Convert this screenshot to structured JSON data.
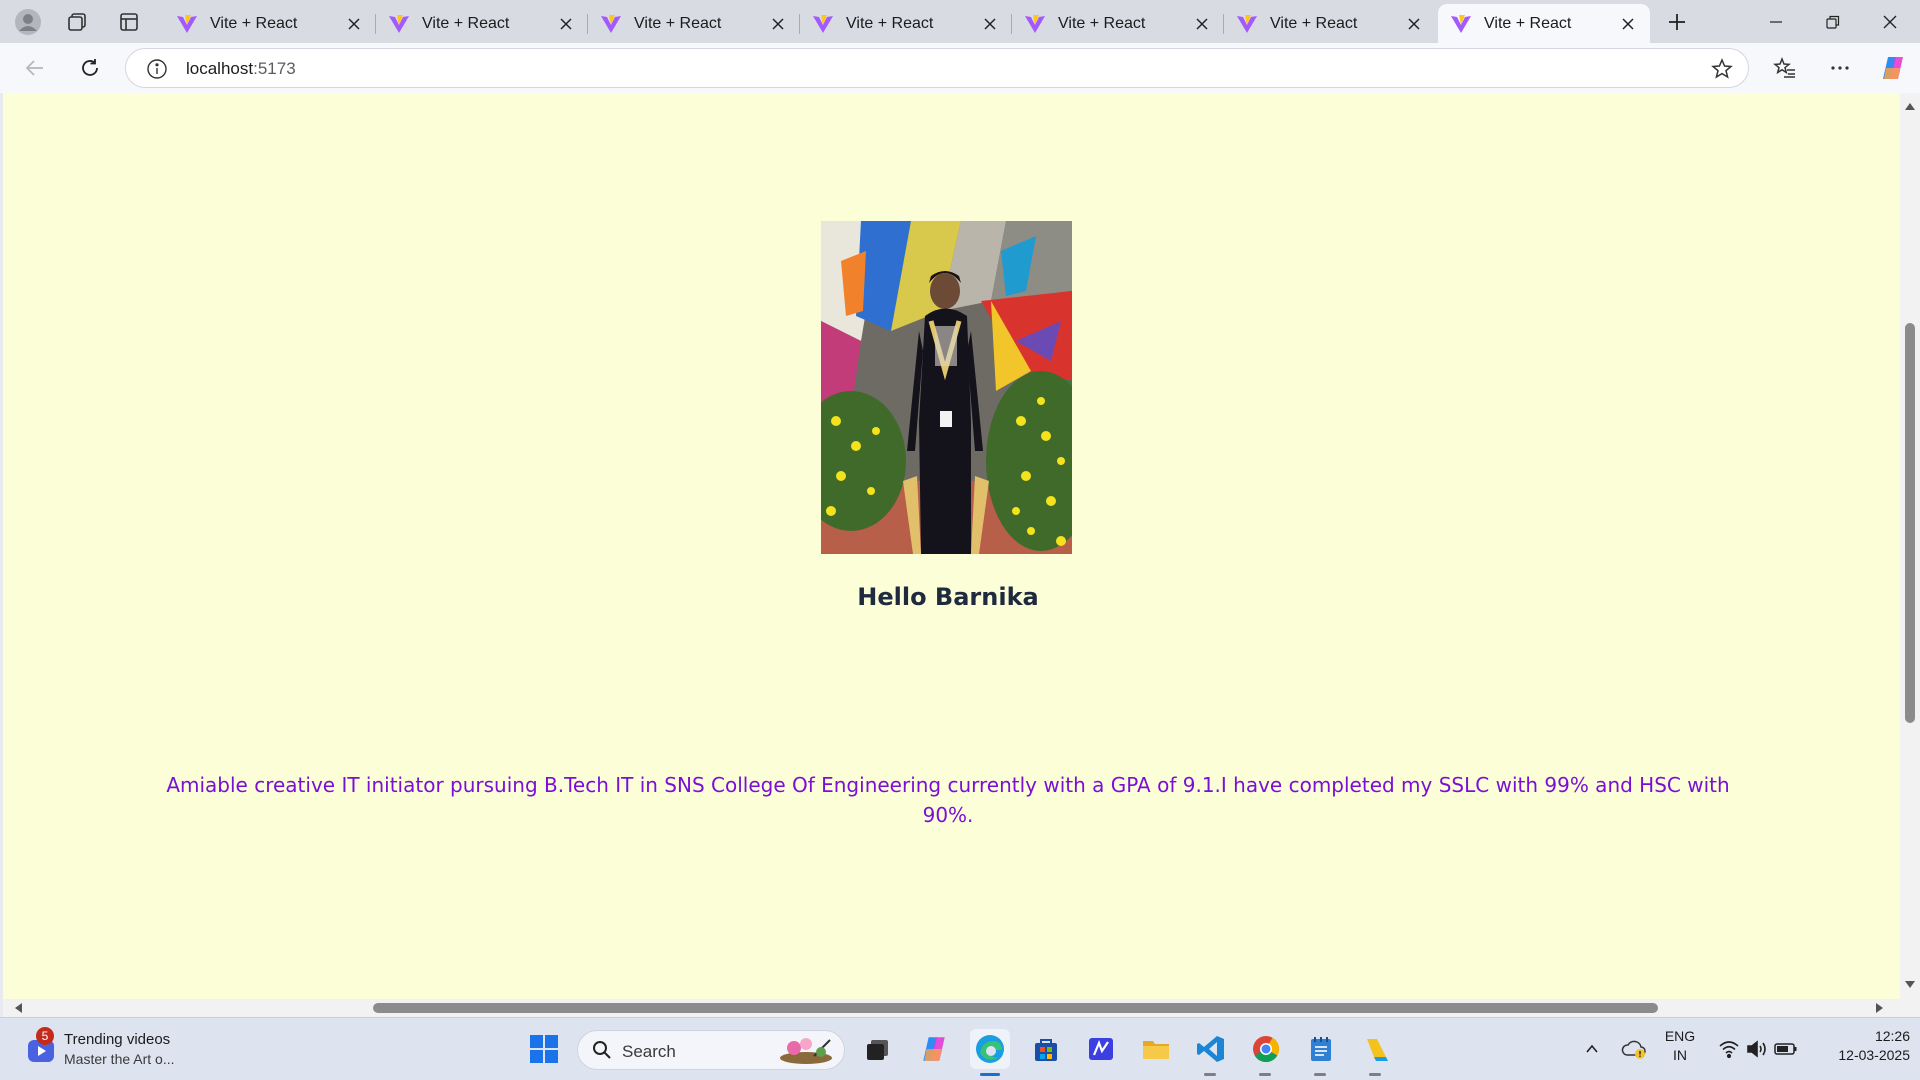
{
  "browser": {
    "tabs": [
      {
        "title": "Vite + React",
        "active": false
      },
      {
        "title": "Vite + React",
        "active": false
      },
      {
        "title": "Vite + React",
        "active": false
      },
      {
        "title": "Vite + React",
        "active": false
      },
      {
        "title": "Vite + React",
        "active": false
      },
      {
        "title": "Vite + React",
        "active": false
      },
      {
        "title": "Vite + React",
        "active": true
      }
    ],
    "address": {
      "host": "localhost",
      "port": ":5173"
    }
  },
  "page": {
    "greeting": "Hello Barnika",
    "bio": "Amiable creative IT initiator pursuing B.Tech IT in SNS College Of Engineering currently with a GPA of 9.1.I have completed my SSLC with 99% and HSC with 90%.",
    "background_color": "#fcfed8",
    "bio_color": "#7a10d8"
  },
  "taskbar": {
    "widget": {
      "title": "Trending videos",
      "subtitle": "Master the Art o...",
      "badge": "5"
    },
    "search_label": "Search",
    "language": {
      "line1": "ENG",
      "line2": "IN"
    },
    "clock": {
      "time": "12:26",
      "date": "12-03-2025"
    }
  }
}
